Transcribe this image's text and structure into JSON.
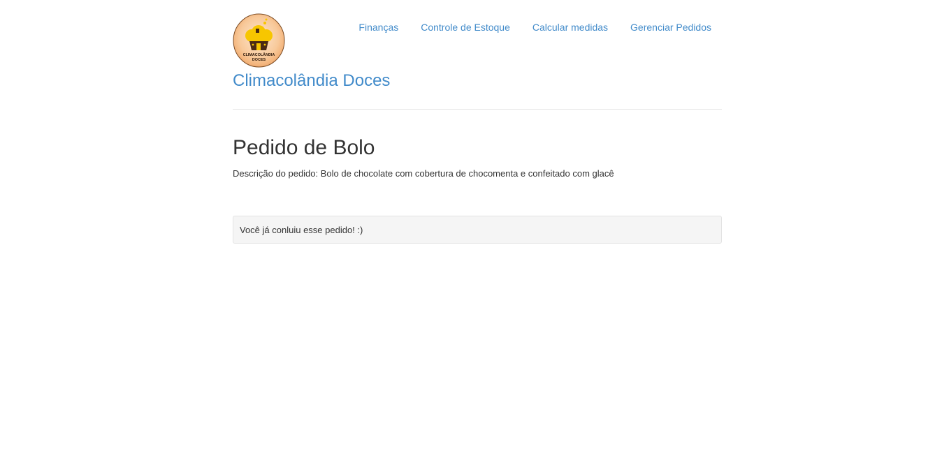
{
  "header": {
    "logo": {
      "icon": "cupcake-logo-icon",
      "text_line1": "CLIMACOLÂNDIA",
      "text_line2": "DOCES"
    },
    "brand": "Climacolândia Doces",
    "nav": [
      {
        "label": "Finanças"
      },
      {
        "label": "Controle de Estoque"
      },
      {
        "label": "Calcular medidas"
      },
      {
        "label": "Gerenciar Pedidos"
      }
    ]
  },
  "main": {
    "title": "Pedido de Bolo",
    "description": "Descrição do pedido: Bolo de chocolate com cobertura de chocomenta e confeitado com glacê",
    "notice": "Você já conluiu esse pedido! :)"
  },
  "colors": {
    "link": "#428bca",
    "text": "#333333",
    "well_bg": "#f5f5f5",
    "well_border": "#e3e3e3"
  }
}
